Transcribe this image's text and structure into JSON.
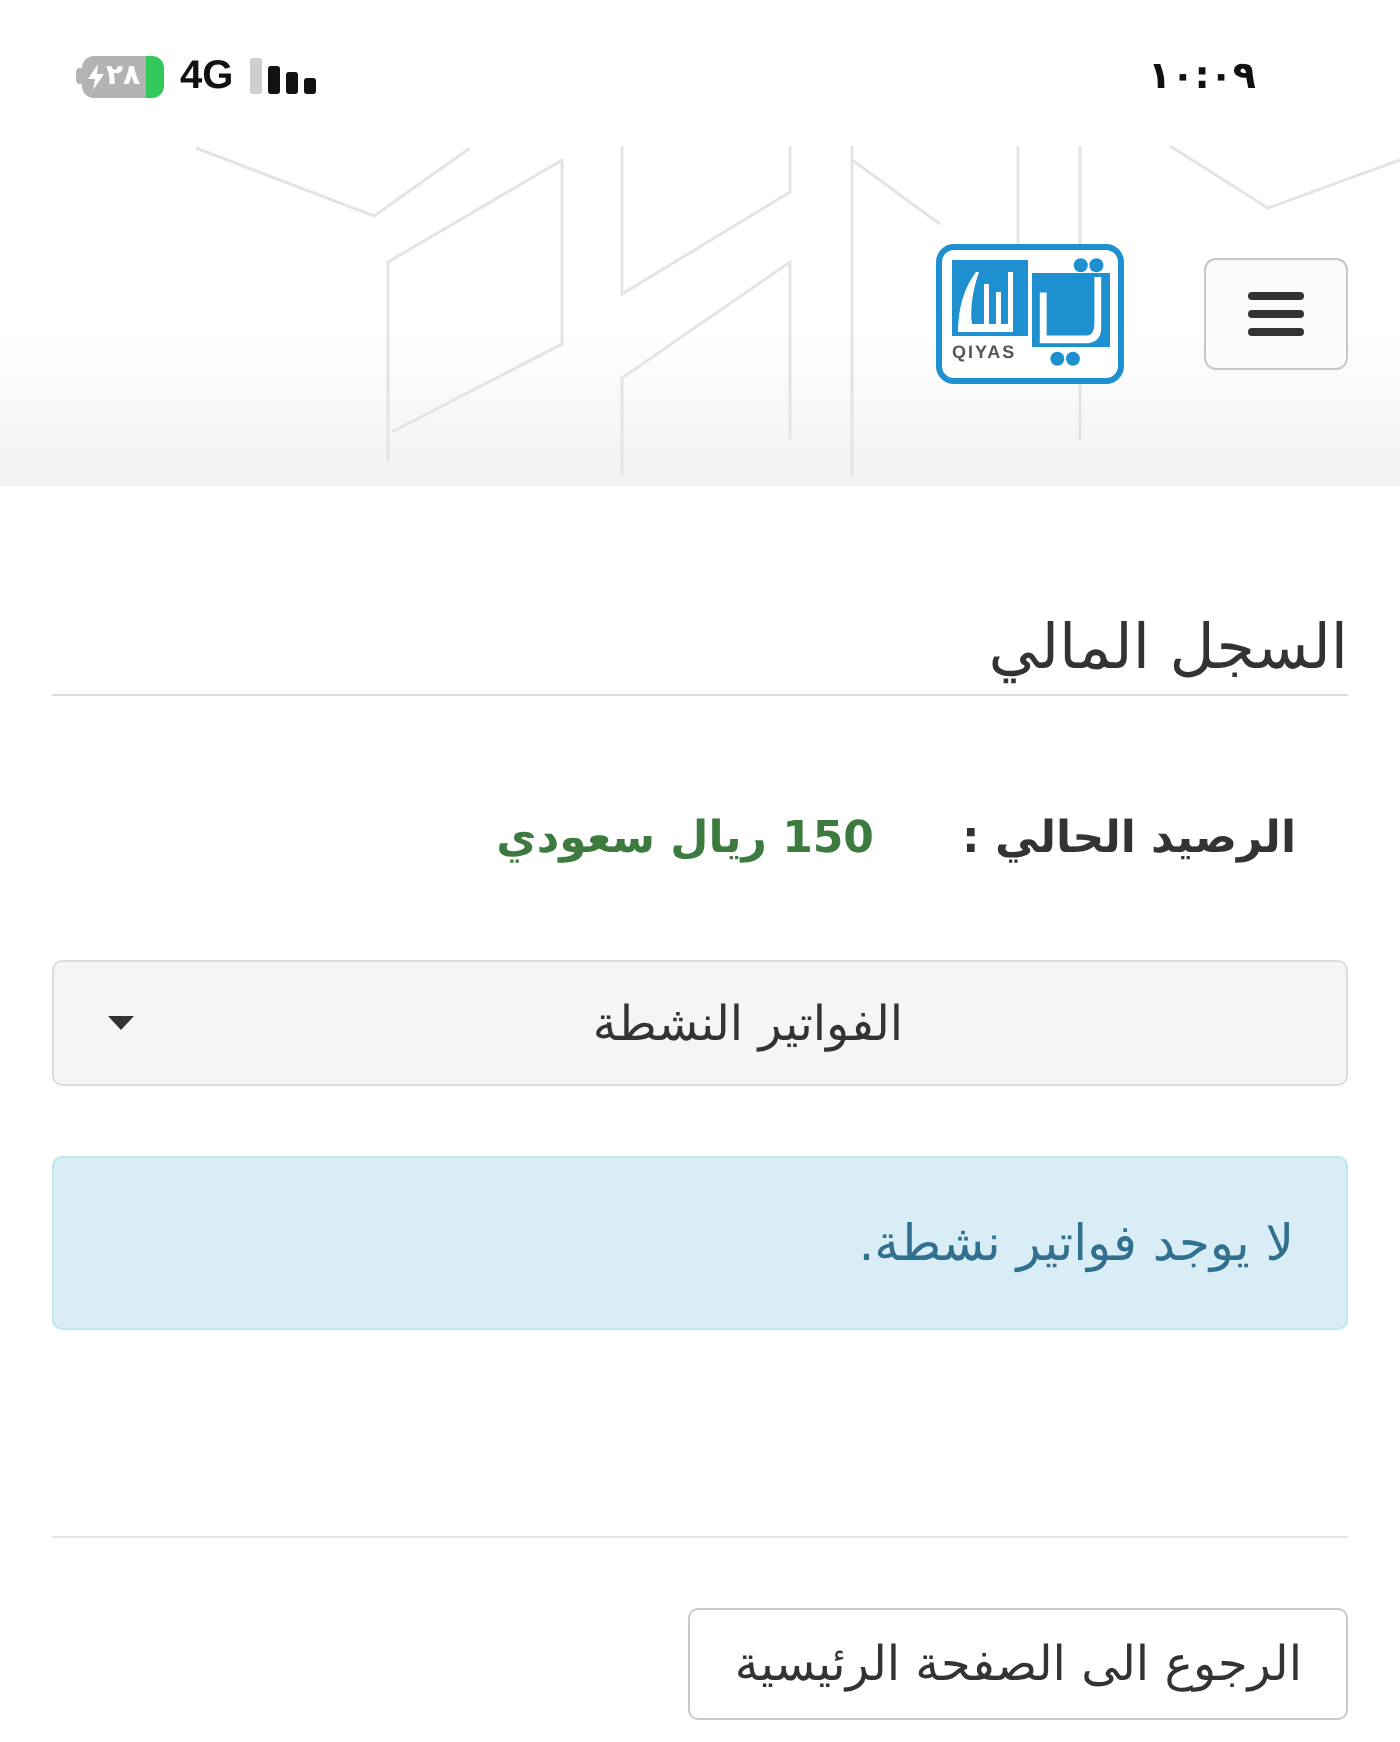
{
  "status_bar": {
    "time": "١٠:٠٩",
    "battery": "٢٨",
    "charging": true,
    "network": "4G"
  },
  "header": {
    "logo_text": "QIYAS"
  },
  "page": {
    "title": "السجل المالي"
  },
  "balance": {
    "label": "الرصيد الحالي :",
    "value": "150 ريال سعودي"
  },
  "invoices_dropdown": {
    "label": "الفواتير النشطة"
  },
  "alert": {
    "kind": "info",
    "message": "لا يوجد فواتير نشطة."
  },
  "back_button": {
    "label": "الرجوع الى الصفحة الرئيسية"
  }
}
